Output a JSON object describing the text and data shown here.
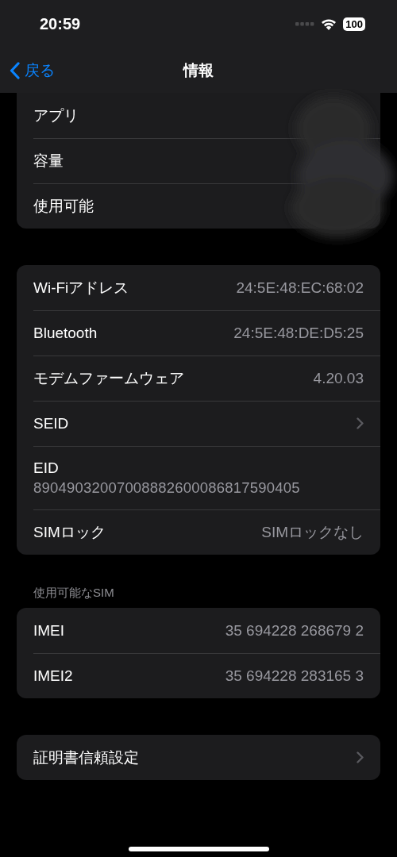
{
  "status_bar": {
    "time": "20:59",
    "battery": "100"
  },
  "nav_bar": {
    "back": "戻る",
    "title": "情報"
  },
  "groups": [
    {
      "cut_top": true,
      "rows": [
        {
          "kind": "plain",
          "label": "アプリ"
        },
        {
          "kind": "plain",
          "label": "容量"
        },
        {
          "kind": "plain",
          "label": "使用可能"
        }
      ]
    },
    {
      "rows": [
        {
          "kind": "value",
          "label": "Wi-Fiアドレス",
          "value": "24:5E:48:EC:68:02"
        },
        {
          "kind": "value",
          "label": "Bluetooth",
          "value": "24:5E:48:DE:D5:25"
        },
        {
          "kind": "value",
          "label": "モデムファームウェア",
          "value": "4.20.03"
        },
        {
          "kind": "link",
          "label": "SEID"
        },
        {
          "kind": "stacked",
          "label": "EID",
          "value": "89049032007008882600086817590405"
        },
        {
          "kind": "value",
          "label": "SIMロック",
          "value": "SIMロックなし"
        }
      ]
    },
    {
      "header": "使用可能なSIM",
      "rows": [
        {
          "kind": "value",
          "label": "IMEI",
          "value": "35 694228 268679 2"
        },
        {
          "kind": "value",
          "label": "IMEI2",
          "value": "35 694228 283165 3"
        }
      ]
    },
    {
      "rows": [
        {
          "kind": "link",
          "label": "証明書信頼設定"
        }
      ]
    }
  ]
}
